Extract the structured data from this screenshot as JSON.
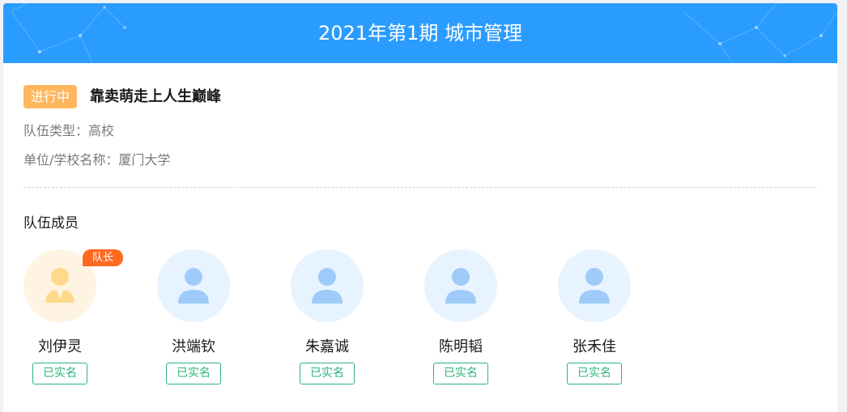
{
  "header": {
    "title": "2021年第1期 城市管理"
  },
  "team": {
    "status": "进行中",
    "name": "靠卖萌走上人生巅峰",
    "type_line": "队伍类型：高校",
    "unit_line": "单位/学校名称：厦门大学"
  },
  "members_section": {
    "title": "队伍成员",
    "leader_tag": "队长",
    "verified_label": "已实名",
    "members": [
      {
        "name": "刘伊灵"
      },
      {
        "name": "洪端钦"
      },
      {
        "name": "朱嘉诚"
      },
      {
        "name": "陈明韬"
      },
      {
        "name": "张禾佳"
      }
    ]
  },
  "colors": {
    "banner": "#2b9cff",
    "status_badge": "#ffb65e",
    "leader_tag": "#ff6a21",
    "verified": "#2bb57c",
    "avatar_bg": "#e7f3fe",
    "avatar_icon": "#9ecbfa",
    "leader_avatar_bg": "#fff4e1",
    "leader_avatar_icon": "#ffd98c"
  },
  "icons": {
    "avatar": "user-avatar-icon",
    "leader_avatar": "user-suit-icon"
  }
}
